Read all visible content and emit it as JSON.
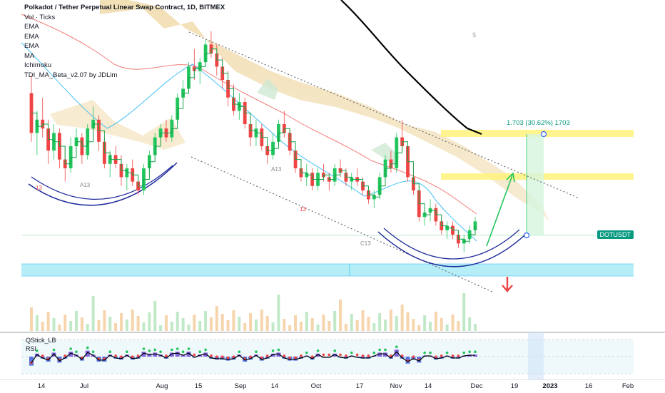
{
  "legend": {
    "title": "Polkadot / Tether Perpetual Linear Swap Contract, 1D, BITMEX",
    "indicators": [
      "Vol · Ticks",
      "EMA",
      "EMA",
      "EMA",
      "MA",
      "Ichimoku",
      "TDI_MA_Beta_v2.07 by JDLim"
    ]
  },
  "oscillator": {
    "label1": "QStick_LB",
    "label2": "RSI"
  },
  "price_tag": "DOTUSDT",
  "measure": {
    "text": "1.703 (30.62%) 1703"
  },
  "xaxis": {
    "ticks": [
      {
        "label": "14",
        "bold": false
      },
      {
        "label": "Jul",
        "bold": false
      },
      {
        "label": "Aug",
        "bold": false
      },
      {
        "label": "15",
        "bold": false
      },
      {
        "label": "Sep",
        "bold": false
      },
      {
        "label": "14",
        "bold": false
      },
      {
        "label": "Oct",
        "bold": false
      },
      {
        "label": "17",
        "bold": false
      },
      {
        "label": "Nov",
        "bold": false
      },
      {
        "label": "14",
        "bold": false
      },
      {
        "label": "Dec",
        "bold": false
      },
      {
        "label": "19",
        "bold": false
      },
      {
        "label": "2023",
        "bold": true
      },
      {
        "label": "16",
        "bold": false
      },
      {
        "label": "Feb",
        "bold": false
      }
    ]
  },
  "markers": [
    "A13",
    "13",
    "A13",
    "13",
    "C13"
  ],
  "colors": {
    "up": "#22c55e",
    "down": "#ef4444",
    "ema_fast": "#ef5350",
    "ema_slow": "#29b6f6",
    "support_zone": "#9ce8f4",
    "resistance_zone": "#fff27a",
    "channel": "#5d606b"
  },
  "chart_data": {
    "type": "candlestick",
    "symbol": "DOTUSDT",
    "interval": "1D",
    "note_direction_up": "projected bounce",
    "candles": [
      [
        8.2,
        8.6,
        7.1,
        7.3
      ],
      [
        7.3,
        7.8,
        6.8,
        7.6
      ],
      [
        7.6,
        8.1,
        7.2,
        7.4
      ],
      [
        7.4,
        7.6,
        6.6,
        6.9
      ],
      [
        6.9,
        7.5,
        6.7,
        7.3
      ],
      [
        7.3,
        7.4,
        6.5,
        6.7
      ],
      [
        6.7,
        7.0,
        6.2,
        6.5
      ],
      [
        6.5,
        7.2,
        6.4,
        7.0
      ],
      [
        7.0,
        7.4,
        6.8,
        7.2
      ],
      [
        7.2,
        7.3,
        6.6,
        6.8
      ],
      [
        6.8,
        7.5,
        6.7,
        7.4
      ],
      [
        7.4,
        7.9,
        7.1,
        7.6
      ],
      [
        7.6,
        7.7,
        6.9,
        7.1
      ],
      [
        7.1,
        7.2,
        6.5,
        6.6
      ],
      [
        6.6,
        6.9,
        6.3,
        6.8
      ],
      [
        6.8,
        7.0,
        6.5,
        6.6
      ],
      [
        6.6,
        6.8,
        6.1,
        6.3
      ],
      [
        6.3,
        6.6,
        6.0,
        6.5
      ],
      [
        6.5,
        6.7,
        6.1,
        6.2
      ],
      [
        6.2,
        6.3,
        5.9,
        6.0
      ],
      [
        6.0,
        6.6,
        5.9,
        6.5
      ],
      [
        6.5,
        6.9,
        6.4,
        6.8
      ],
      [
        6.8,
        7.3,
        6.7,
        7.2
      ],
      [
        7.2,
        7.5,
        7.0,
        7.4
      ],
      [
        7.4,
        7.6,
        7.1,
        7.2
      ],
      [
        7.2,
        7.7,
        7.1,
        7.6
      ],
      [
        7.6,
        8.2,
        7.5,
        8.1
      ],
      [
        8.1,
        8.5,
        7.9,
        8.3
      ],
      [
        8.3,
        8.9,
        8.2,
        8.8
      ],
      [
        8.8,
        9.2,
        8.5,
        8.7
      ],
      [
        8.7,
        9.0,
        8.4,
        8.9
      ],
      [
        8.9,
        9.4,
        8.8,
        9.3
      ],
      [
        9.3,
        9.6,
        9.0,
        9.1
      ],
      [
        9.1,
        9.3,
        8.6,
        8.8
      ],
      [
        8.8,
        9.0,
        8.3,
        8.5
      ],
      [
        8.5,
        8.7,
        7.9,
        8.1
      ],
      [
        8.1,
        8.4,
        7.7,
        7.8
      ],
      [
        7.8,
        8.2,
        7.6,
        8.0
      ],
      [
        8.0,
        8.1,
        7.4,
        7.5
      ],
      [
        7.5,
        7.7,
        7.0,
        7.2
      ],
      [
        7.2,
        7.6,
        7.0,
        7.4
      ],
      [
        7.4,
        7.5,
        6.9,
        7.0
      ],
      [
        7.0,
        7.1,
        6.6,
        6.8
      ],
      [
        6.8,
        7.3,
        6.7,
        7.1
      ],
      [
        7.1,
        7.6,
        7.0,
        7.5
      ],
      [
        7.5,
        7.8,
        7.2,
        7.3
      ],
      [
        7.3,
        7.4,
        6.8,
        6.9
      ],
      [
        6.9,
        7.0,
        6.4,
        6.5
      ],
      [
        6.5,
        6.7,
        6.2,
        6.3
      ],
      [
        6.3,
        6.6,
        6.1,
        6.4
      ],
      [
        6.4,
        6.5,
        6.0,
        6.1
      ],
      [
        6.1,
        6.5,
        6.0,
        6.4
      ],
      [
        6.4,
        6.6,
        6.2,
        6.3
      ],
      [
        6.3,
        6.4,
        6.0,
        6.2
      ],
      [
        6.2,
        6.6,
        6.1,
        6.5
      ],
      [
        6.5,
        6.7,
        6.3,
        6.4
      ],
      [
        6.4,
        6.5,
        6.1,
        6.2
      ],
      [
        6.2,
        6.4,
        6.0,
        6.3
      ],
      [
        6.3,
        6.5,
        6.1,
        6.2
      ],
      [
        6.2,
        6.3,
        5.9,
        6.0
      ],
      [
        6.0,
        6.1,
        5.7,
        5.8
      ],
      [
        5.8,
        6.0,
        5.6,
        5.9
      ],
      [
        5.9,
        6.4,
        5.8,
        6.3
      ],
      [
        6.3,
        6.8,
        6.2,
        6.7
      ],
      [
        6.7,
        6.9,
        6.4,
        6.5
      ],
      [
        6.5,
        7.3,
        6.4,
        7.2
      ],
      [
        7.2,
        7.6,
        6.9,
        7.0
      ],
      [
        7.0,
        7.1,
        6.2,
        6.3
      ],
      [
        6.3,
        6.6,
        5.9,
        6.0
      ],
      [
        6.0,
        6.1,
        5.3,
        5.4
      ],
      [
        5.4,
        5.6,
        5.2,
        5.5
      ],
      [
        5.5,
        5.8,
        5.3,
        5.6
      ],
      [
        5.6,
        5.7,
        5.2,
        5.3
      ],
      [
        5.3,
        5.4,
        5.0,
        5.1
      ],
      [
        5.1,
        5.3,
        4.9,
        5.2
      ],
      [
        5.2,
        5.3,
        4.9,
        5.0
      ],
      [
        5.0,
        5.1,
        4.7,
        4.8
      ],
      [
        4.8,
        5.0,
        4.6,
        4.9
      ],
      [
        4.9,
        5.2,
        4.8,
        5.1
      ],
      [
        5.1,
        5.4,
        5.0,
        5.3
      ]
    ],
    "annotations": {
      "measure_target": 1.703,
      "measure_percent": "30.62%"
    }
  }
}
